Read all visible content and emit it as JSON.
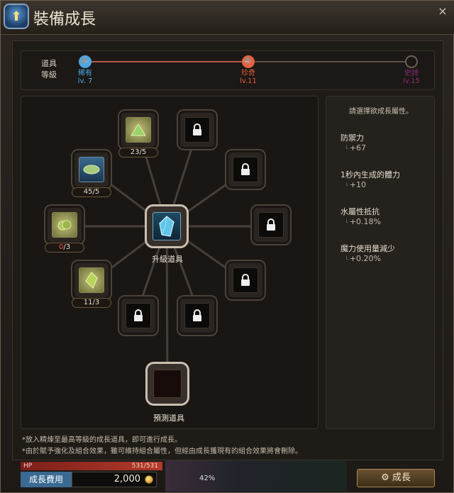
{
  "window": {
    "title": "裝備成長",
    "close_symbol": "×"
  },
  "grade": {
    "label_line1": "道具",
    "label_line2": "等級",
    "nodes": [
      {
        "name": "稀有",
        "level": "lv. 7",
        "color": "#4aa9e6",
        "state": "done"
      },
      {
        "name": "珍奇",
        "level": "lv.11",
        "color": "#e5603d",
        "state": "current"
      },
      {
        "name": "史詩",
        "level": "lv.15",
        "color": "#8a2a78",
        "state": "locked"
      }
    ],
    "progress_fraction": 0.51
  },
  "tree": {
    "center_label": "升級道具",
    "preview_label": "預測道具",
    "slots": [
      {
        "id": "top-left-upper",
        "kind": "material",
        "icon": "green-crystal-icon",
        "count_current": "23",
        "count_max": "5",
        "current_red": false
      },
      {
        "id": "left-upper",
        "kind": "material",
        "icon": "jade-leaf-icon",
        "count_current": "45",
        "count_max": "5",
        "current_red": false
      },
      {
        "id": "left",
        "kind": "material",
        "icon": "seed-pod-icon",
        "count_current": "0",
        "count_max": "3",
        "current_red": true
      },
      {
        "id": "left-lower",
        "kind": "material",
        "icon": "green-shard-icon",
        "count_current": "11",
        "count_max": "3",
        "current_red": false
      }
    ]
  },
  "attributes": {
    "title": "請選擇欲成長屬性。",
    "items": [
      {
        "name": "防禦力",
        "value": "+67"
      },
      {
        "name": "1秒內生成的體力",
        "value": "+10"
      },
      {
        "name": "水屬性抵抗",
        "value": "+0.18%"
      },
      {
        "name": "魔力使用量減少",
        "value": "+0.20%"
      }
    ]
  },
  "notes": [
    "*放入精煉至最高等級的成長道具，即可進行成長。",
    "*由於賦予強化及組合效果，雖可維持組合屬性，但經由成長獲現有的組合效果將會刪除。"
  ],
  "footer": {
    "hp_label": "HP",
    "hp_value": "531/531",
    "cost_label": "成長費用",
    "cost_value": "2,000",
    "grow_button": "成長",
    "grow_icon": "gear-icon",
    "background_percent": "42%"
  },
  "colors": {
    "accent_red": "#b8584a",
    "count_red": "#ff4b3a"
  }
}
